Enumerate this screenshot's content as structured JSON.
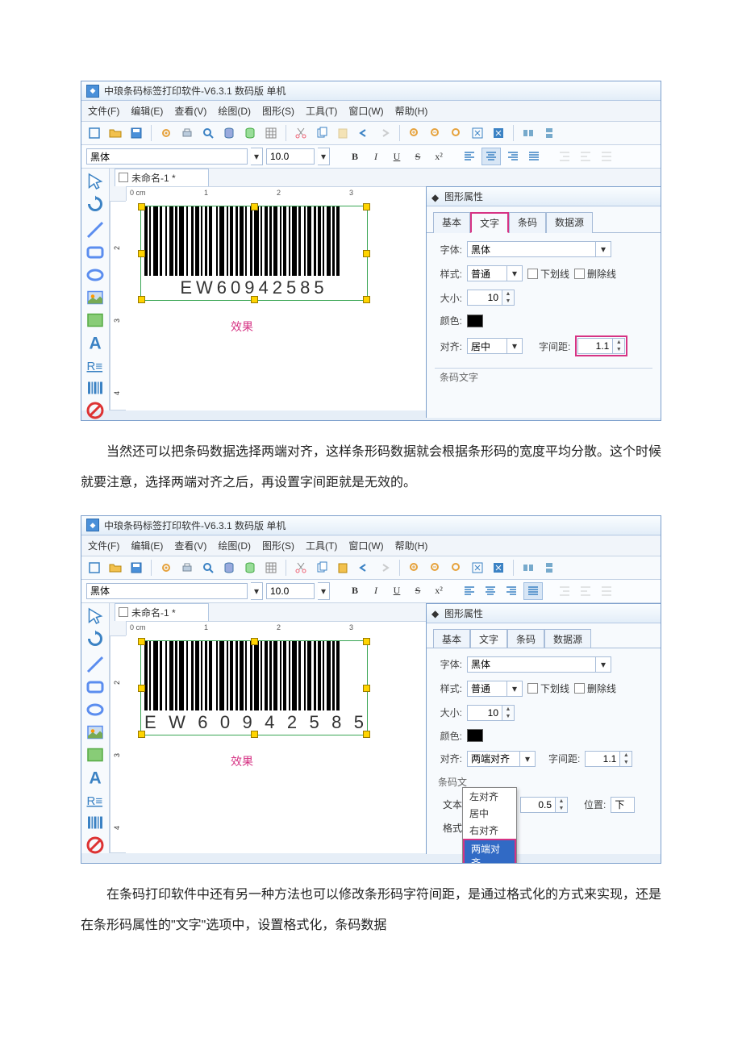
{
  "app": {
    "title": "中琅条码标签打印软件-V6.3.1 数码版 单机"
  },
  "menu": {
    "file": "文件(F)",
    "edit": "编辑(E)",
    "view": "查看(V)",
    "draw": "绘图(D)",
    "shape": "图形(S)",
    "tool": "工具(T)",
    "window": "窗口(W)",
    "help": "帮助(H)"
  },
  "fmt": {
    "font": "黑体",
    "size": "10.0",
    "bold": "B",
    "italic": "I",
    "underline": "U",
    "strike": "S"
  },
  "doc": {
    "tab": "未命名-1 *"
  },
  "ruler": {
    "unit": "0 cm",
    "t1": "1",
    "t2": "2",
    "t3": "3",
    "v2": "2",
    "v3": "3",
    "v4": "4"
  },
  "barcode": {
    "text": "EW60942585",
    "effect": "效果",
    "text_justify": "E W 6 0 9 4 2 5 8 5"
  },
  "panel": {
    "title": "图形属性",
    "tabs": {
      "basic": "基本",
      "text": "文字",
      "barcode": "条码",
      "datasource": "数据源"
    },
    "lbl": {
      "font": "字体:",
      "style": "样式:",
      "size": "大小:",
      "color": "颜色:",
      "align": "对齐:",
      "spacing": "字间距:",
      "bartext": "条码文字",
      "textspace": "文本",
      "format": "格式",
      "pos": "位置:"
    },
    "val": {
      "font": "黑体",
      "style": "普通",
      "size": "10",
      "align_center": "居中",
      "align_justify": "两端对齐",
      "spacing": "1.1",
      "textspace": "0.5",
      "pos": "下"
    },
    "chk": {
      "underline": "下划线",
      "strike": "删除线"
    },
    "align_options": {
      "left": "左对齐",
      "center": "居中",
      "right": "右对齐",
      "justify": "两端对齐"
    }
  },
  "para1": "当然还可以把条码数据选择两端对齐，这样条形码数据就会根据条形码的宽度平均分散。这个时候就要注意，选择两端对齐之后，再设置字间距就是无效的。",
  "para2": "在条码打印软件中还有另一种方法也可以修改条形码字符间距，是通过格式化的方式来实现，还是在条形码属性的\"文字\"选项中，设置格式化，条码数据"
}
